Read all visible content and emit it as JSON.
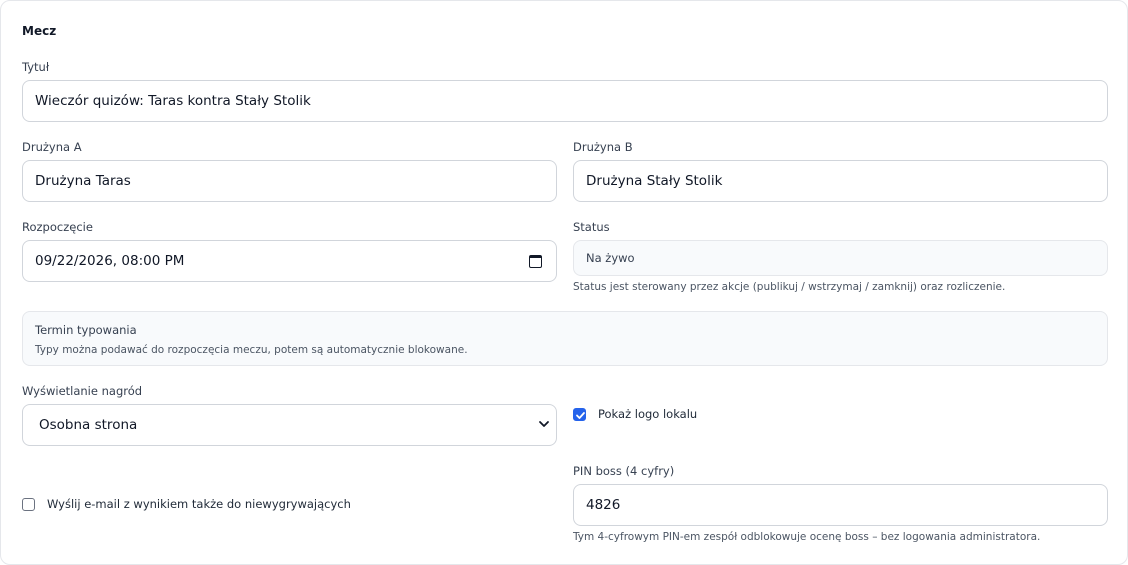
{
  "section": {
    "title": "Mecz"
  },
  "title_field": {
    "label": "Tytuł",
    "value": "Wieczór quizów: Taras kontra Stały Stolik"
  },
  "team_a": {
    "label": "Drużyna A",
    "value": "Drużyna Taras"
  },
  "team_b": {
    "label": "Drużyna B",
    "value": "Drużyna Stały Stolik"
  },
  "start": {
    "label": "Rozpoczęcie",
    "value": "09/22/2026, 08:00 PM"
  },
  "status": {
    "label": "Status",
    "value": "Na żywo",
    "hint": "Status jest sterowany przez akcje (publikuj / wstrzymaj / zamknij) oraz rozliczenie."
  },
  "deadline": {
    "title": "Termin typowania",
    "text": "Typy można podawać do rozpoczęcia meczu, potem są automatycznie blokowane."
  },
  "prizes": {
    "label": "Wyświetlanie nagród",
    "value": "Osobna strona"
  },
  "show_logo": {
    "label": "Pokaż logo lokalu",
    "checked": true
  },
  "email_losers": {
    "label": "Wyślij e-mail z wynikiem także do niewygrywających",
    "checked": false
  },
  "pin": {
    "label": "PIN boss (4 cyfry)",
    "value": "4826",
    "hint": "Tym 4-cyfrowym PIN-em zespół odblokowuje ocenę boss – bez logowania administratora."
  },
  "colors": {
    "accent": "#2563eb",
    "border": "#d1d5db",
    "muted_bg": "#f8fafc"
  }
}
